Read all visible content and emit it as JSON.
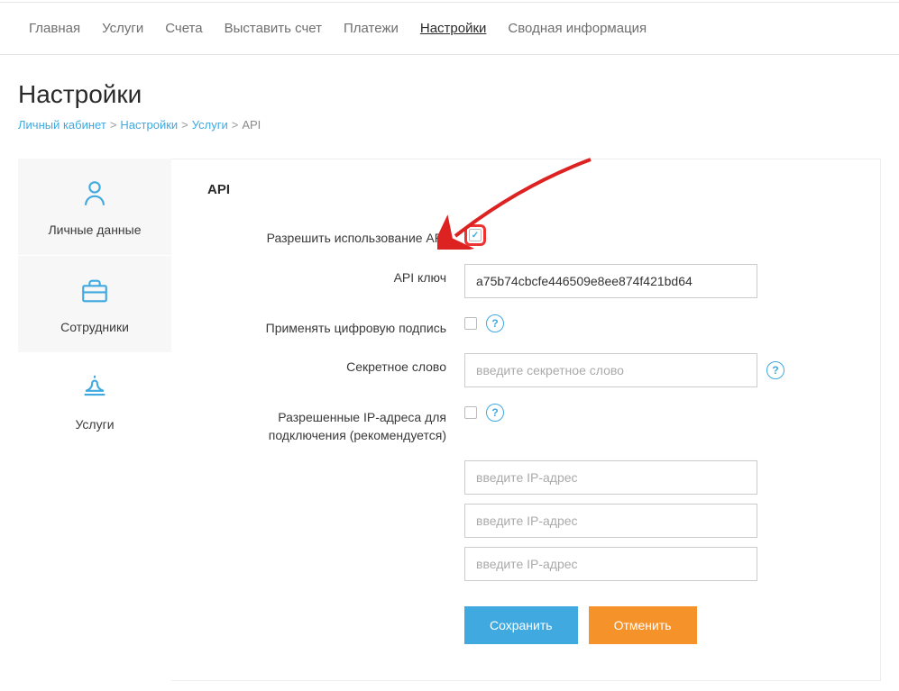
{
  "topnav": [
    {
      "label": "Главная",
      "active": false
    },
    {
      "label": "Услуги",
      "active": false
    },
    {
      "label": "Счета",
      "active": false
    },
    {
      "label": "Выставить счет",
      "active": false
    },
    {
      "label": "Платежи",
      "active": false
    },
    {
      "label": "Настройки",
      "active": true
    },
    {
      "label": "Сводная информация",
      "active": false
    }
  ],
  "page_title": "Настройки",
  "breadcrumb": [
    {
      "label": "Личный кабинет",
      "link": true
    },
    {
      "label": "Настройки",
      "link": true
    },
    {
      "label": "Услуги",
      "link": true
    },
    {
      "label": "API",
      "link": false
    }
  ],
  "sidebar": {
    "items": [
      {
        "id": "personal",
        "label": "Личные данные",
        "icon": "person",
        "active": false
      },
      {
        "id": "employees",
        "label": "Сотрудники",
        "icon": "briefcase",
        "active": false
      },
      {
        "id": "services",
        "label": "Услуги",
        "icon": "bell",
        "active": true
      }
    ]
  },
  "form": {
    "section_title": "API",
    "allow_api_label": "Разрешить использование API",
    "allow_api_checked": true,
    "api_key_label": "API ключ",
    "api_key_value": "a75b74cbcfe446509e8ee874f421bd64",
    "digital_sign_label": "Применять цифровую подпись",
    "digital_sign_checked": false,
    "secret_label": "Секретное слово",
    "secret_placeholder": "введите секретное слово",
    "secret_value": "",
    "ip_label": "Разрешенные IP-адреса для подключения (рекомендуется)",
    "ip_checked": false,
    "ip_placeholder": "введите IP-адрес",
    "ip_values": [
      "",
      "",
      ""
    ],
    "save_label": "Сохранить",
    "cancel_label": "Отменить"
  },
  "help_glyph": "?"
}
